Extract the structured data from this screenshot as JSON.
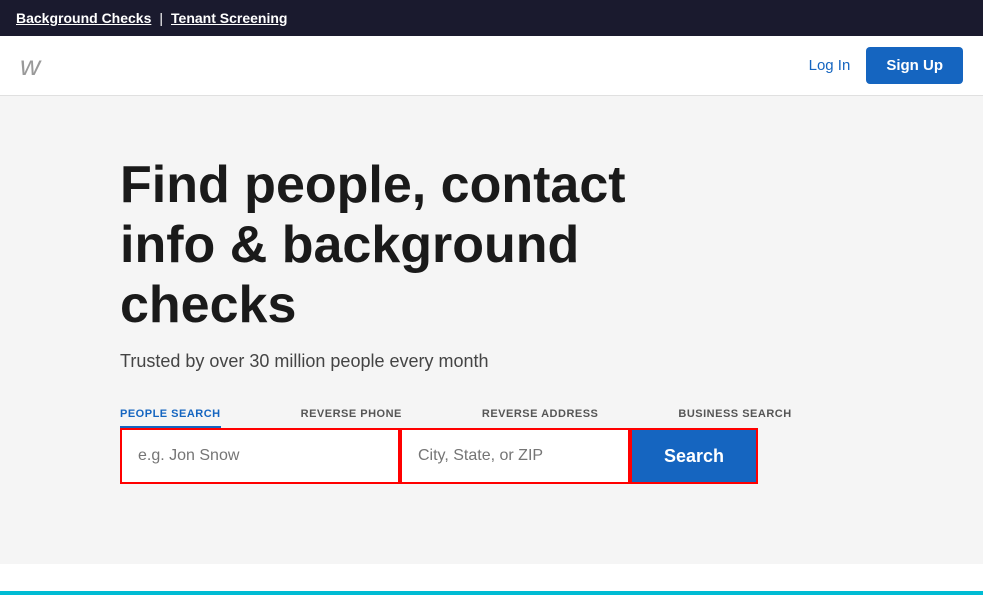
{
  "topbar": {
    "link1": "Background Checks",
    "divider": "|",
    "link2": "Tenant Screening"
  },
  "header": {
    "logo": "w",
    "login_label": "Log In",
    "signup_label": "Sign Up"
  },
  "hero": {
    "title": "Find people, contact info & background checks",
    "subtitle": "Trusted by over 30 million people every month"
  },
  "search": {
    "tabs": [
      {
        "id": "people",
        "label": "PEOPLE SEARCH",
        "active": true
      },
      {
        "id": "phone",
        "label": "REVERSE PHONE",
        "active": false
      },
      {
        "id": "address",
        "label": "REVERSE ADDRESS",
        "active": false
      },
      {
        "id": "business",
        "label": "BUSINESS SEARCH",
        "active": false
      }
    ],
    "name_placeholder": "e.g. Jon Snow",
    "location_placeholder": "City, State, or ZIP",
    "phone_placeholder": "",
    "business_placeholder": "",
    "button_label": "Search"
  }
}
